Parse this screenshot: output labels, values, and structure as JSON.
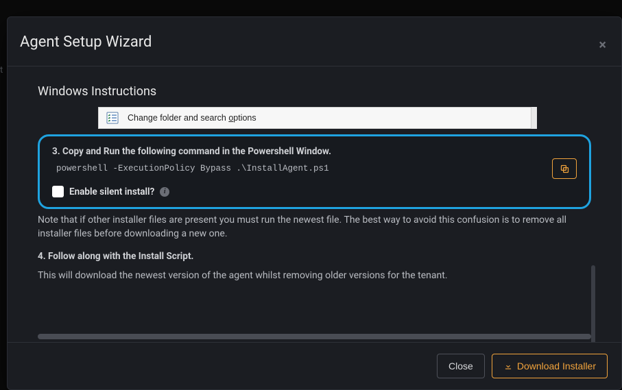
{
  "modal": {
    "title": "Agent Setup Wizard",
    "close_x": "×"
  },
  "behind_tab": "t",
  "section_title": "Windows Instructions",
  "win_menu": {
    "text_prefix": "Change folder and search ",
    "underlined": "o",
    "text_suffix": "ptions"
  },
  "step3": {
    "heading": "3. Copy and Run the following command in the Powershell Window.",
    "command": "powershell -ExecutionPolicy Bypass .\\InstallAgent.ps1",
    "checkbox_label": "Enable silent install?"
  },
  "note": "Note that if other installer files are present you must run the newest file. The best way to avoid this confusion is to remove all installer files before downloading a new one.",
  "step4": {
    "heading": "4. Follow along with the Install Script.",
    "text": "This will download the newest version of the agent whilst removing older versions for the tenant."
  },
  "footer": {
    "close": "Close",
    "download": "Download Installer"
  }
}
